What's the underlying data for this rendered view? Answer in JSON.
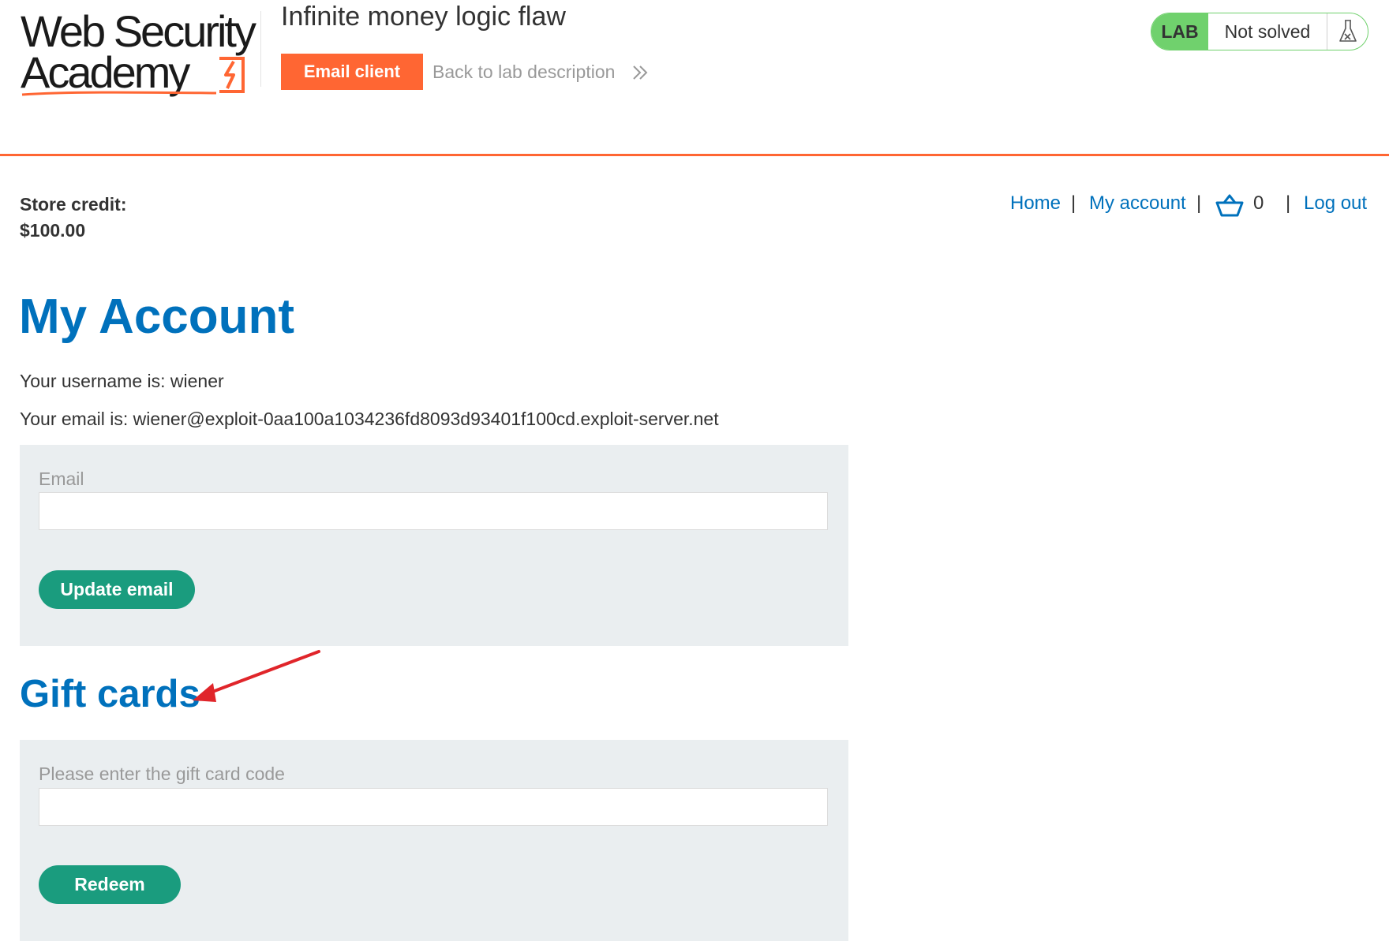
{
  "header": {
    "logo_line1": "Web Security",
    "logo_line2": "Academy",
    "lab_title": "Infinite money logic flaw",
    "email_client_label": "Email client",
    "back_link_label": "Back to lab description",
    "status": {
      "badge": "LAB",
      "text": "Not solved",
      "icon": "flask-icon"
    },
    "accent_color": "#ff6633",
    "status_color": "#70d16d"
  },
  "account_bar": {
    "store_credit_label": "Store credit:",
    "store_credit_value": "$100.00"
  },
  "nav": {
    "home": "Home",
    "my_account": "My account",
    "cart_count": "0",
    "cart_icon": "basket-icon",
    "logout": "Log out",
    "separator": "|",
    "link_color": "#0071bc"
  },
  "main": {
    "title": "My Account",
    "username_line": "Your username is: wiener",
    "email_line": "Your email is: wiener@exploit-0aa100a1034236fd8093d93401f100cd.exploit-server.net",
    "email_form": {
      "label": "Email",
      "value": "",
      "button": "Update email"
    },
    "gift_cards": {
      "title": "Gift cards",
      "label": "Please enter the gift card code",
      "value": "",
      "button": "Redeem"
    },
    "button_color": "#1a9c7e"
  }
}
